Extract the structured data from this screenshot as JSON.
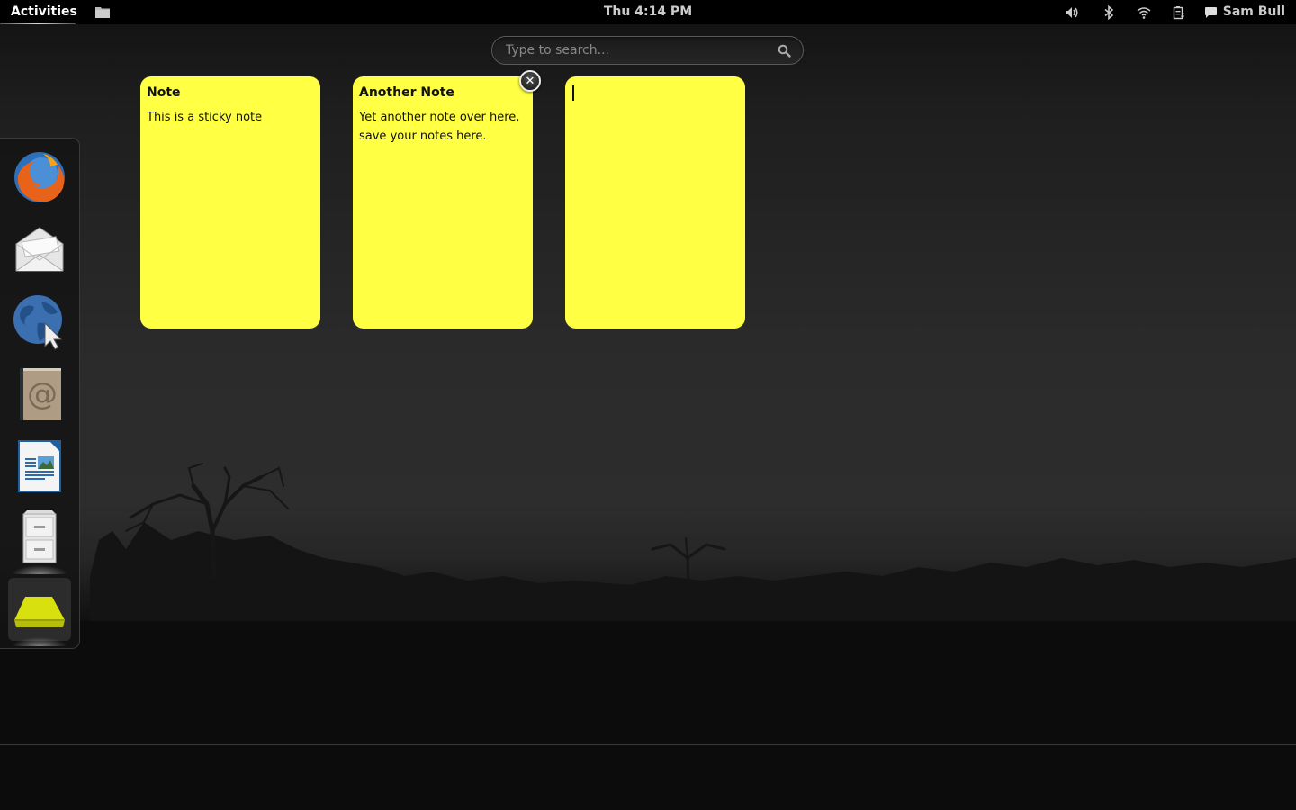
{
  "topbar": {
    "activities_label": "Activities",
    "clock": "Thu  4:14 PM",
    "user_name": "Sam Bull",
    "tray_icons": [
      "volume-icon",
      "bluetooth-icon",
      "wifi-icon",
      "battery-icon",
      "chat-icon"
    ]
  },
  "search": {
    "placeholder": "Type to search...",
    "value": ""
  },
  "dash": {
    "items": [
      {
        "name": "Firefox",
        "icon": "firefox-icon",
        "running": false
      },
      {
        "name": "Mail",
        "icon": "mail-icon",
        "running": false
      },
      {
        "name": "Web Browser",
        "icon": "globe-icon",
        "running": false
      },
      {
        "name": "Contacts",
        "icon": "address-book-icon",
        "running": false
      },
      {
        "name": "LibreOffice Impress",
        "icon": "document-icon",
        "running": false
      },
      {
        "name": "Files",
        "icon": "filing-cabinet-icon",
        "running": true
      },
      {
        "name": "Sticky Notes",
        "icon": "sticky-note-icon",
        "running": true,
        "active": true
      }
    ]
  },
  "notes": [
    {
      "title": "Note",
      "body": "This is a sticky note"
    },
    {
      "title": "Another Note",
      "body": "Yet another note over here, save your notes here."
    },
    {
      "title": "",
      "body": "",
      "editing": true
    }
  ],
  "colors": {
    "note_yellow": "#ffff44",
    "topbar_bg": "#000000",
    "text_light": "#cccccc"
  }
}
